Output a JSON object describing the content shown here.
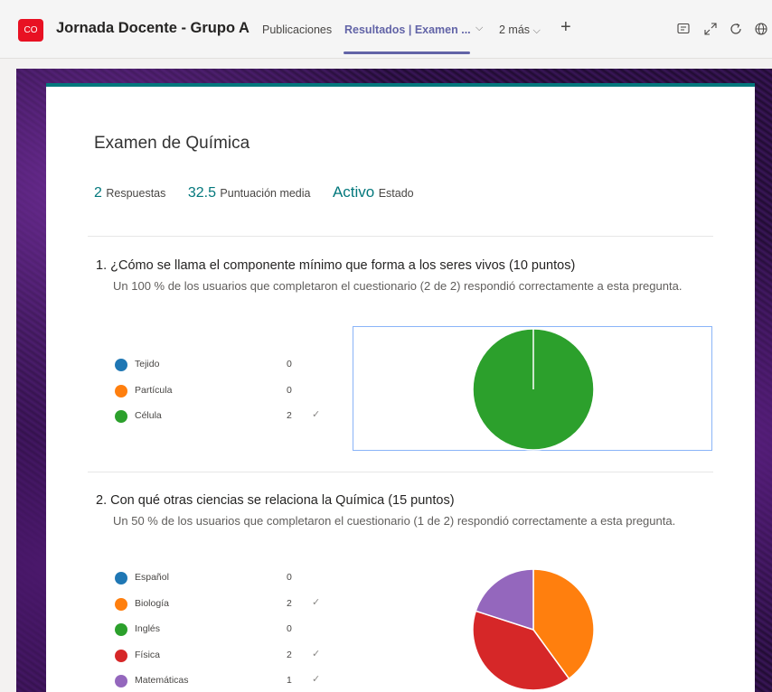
{
  "header": {
    "team_badge": "CO",
    "team_name": "Jornada Docente - Grupo A",
    "tabs": [
      {
        "label": "Publicaciones"
      },
      {
        "label": "Resultados | Examen ..."
      },
      {
        "label": "2 más"
      }
    ],
    "icons": [
      "add-tab-icon",
      "conversation-icon",
      "expand-icon",
      "refresh-icon",
      "globe-icon"
    ]
  },
  "form": {
    "title": "Examen de Química",
    "stats": {
      "responses_value": "2",
      "responses_label": "Respuestas",
      "avg_value": "32.5",
      "avg_label": "Puntuación media",
      "status_value": "Activo",
      "status_label": "Estado"
    }
  },
  "questions": [
    {
      "number": "1.",
      "title": "¿Cómo se llama el componente mínimo que forma a los seres vivos (10 puntos)",
      "description": "Un 100 % de los usuarios que completaron el cuestionario (2 de 2) respondió correctamente a esta pregunta.",
      "options": [
        {
          "label": "Tejido",
          "count": "0",
          "correct": false,
          "color": "#1f77b4"
        },
        {
          "label": "Partícula",
          "count": "0",
          "correct": false,
          "color": "#ff7f0e"
        },
        {
          "label": "Célula",
          "count": "2",
          "correct": true,
          "color": "#2ca02c"
        }
      ]
    },
    {
      "number": "2.",
      "title": "Con qué otras ciencias se relaciona la Química (15 puntos)",
      "description": "Un 50 % de los usuarios que completaron el cuestionario (1 de 2) respondió correctamente a esta pregunta.",
      "options": [
        {
          "label": "Español",
          "count": "0",
          "correct": false,
          "color": "#1f77b4"
        },
        {
          "label": "Biología",
          "count": "2",
          "correct": true,
          "color": "#ff7f0e"
        },
        {
          "label": "Inglés",
          "count": "0",
          "correct": false,
          "color": "#2ca02c"
        },
        {
          "label": "Física",
          "count": "2",
          "correct": true,
          "color": "#d62728"
        },
        {
          "label": "Matemáticas",
          "count": "1",
          "correct": true,
          "color": "#9467bd"
        }
      ]
    }
  ],
  "chart_data": [
    {
      "type": "pie",
      "categories": [
        "Tejido",
        "Partícula",
        "Célula"
      ],
      "values": [
        0,
        0,
        2
      ],
      "colors": [
        "#1f77b4",
        "#ff7f0e",
        "#2ca02c"
      ]
    },
    {
      "type": "pie",
      "categories": [
        "Español",
        "Biología",
        "Inglés",
        "Física",
        "Matemáticas"
      ],
      "values": [
        0,
        2,
        0,
        2,
        1
      ],
      "colors": [
        "#1f77b4",
        "#ff7f0e",
        "#2ca02c",
        "#d62728",
        "#9467bd"
      ]
    }
  ],
  "check_glyph": "✓"
}
